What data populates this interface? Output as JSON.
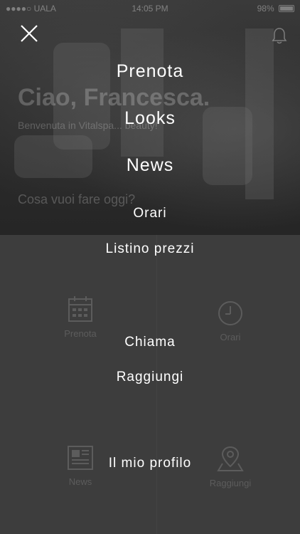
{
  "status_bar": {
    "carrier": "●●●●○ UALA",
    "time": "14:05 PM",
    "battery": "98%",
    "battery_level": 0.98
  },
  "background": {
    "greeting": "Ciao, Francesca.",
    "welcome": "Benvenuta in Vitalspa... beauty!",
    "question": "Cosa vuoi fare oggi?",
    "tiles": [
      {
        "label": "Prenota",
        "icon": "calendar-icon"
      },
      {
        "label": "Orari",
        "icon": "clock-icon"
      },
      {
        "label": "News",
        "icon": "newspaper-icon"
      },
      {
        "label": "Raggiungi",
        "icon": "map-pin-icon"
      }
    ]
  },
  "menu": {
    "close_icon": "close-icon",
    "items": [
      {
        "label": "Prenota"
      },
      {
        "label": "Looks"
      },
      {
        "label": "News"
      },
      {
        "label": "Orari"
      },
      {
        "label": "Listino prezzi"
      },
      {
        "label": "Chiama"
      },
      {
        "label": "Raggiungi"
      },
      {
        "label": "Il mio profilo"
      }
    ]
  }
}
